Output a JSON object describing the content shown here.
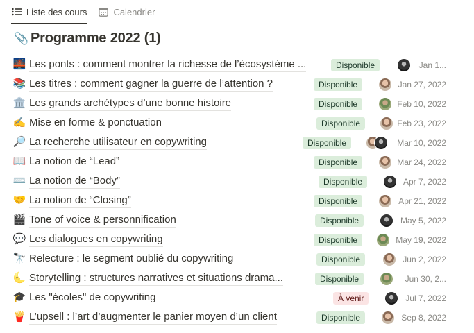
{
  "tabs": [
    {
      "label": "Liste des cours",
      "icon": "list-icon",
      "active": true
    },
    {
      "label": "Calendrier",
      "icon": "calendar-icon",
      "active": false
    }
  ],
  "page": {
    "title": "Programme 2022 (1)",
    "icon": "paperclip-icon"
  },
  "status_colors": {
    "Disponible": "#dbeddb",
    "À venir": "#fbe4e4"
  },
  "rows": [
    {
      "icon": "🌉",
      "name": "Les ponts : comment montrer la richesse de l’écosystème ...",
      "status": "Disponible",
      "date": "Jan 1..."
    },
    {
      "icon": "📚",
      "name": "Les titres : comment gagner la guerre de l’attention ?",
      "status": "Disponible",
      "date": "Jan 27, 2022"
    },
    {
      "icon": "🏛️",
      "name": "Les grands archétypes d’une bonne histoire",
      "status": "Disponible",
      "date": "Feb 10, 2022"
    },
    {
      "icon": "✍️",
      "name": "Mise en forme & ponctuation",
      "status": "Disponible",
      "date": "Feb 23, 2022"
    },
    {
      "icon": "🔎",
      "name": "La recherche utilisateur en copywriting",
      "status": "Disponible",
      "date": "Mar 10, 2022"
    },
    {
      "icon": "📖",
      "name": "La notion de “Lead”",
      "status": "Disponible",
      "date": "Mar 24, 2022"
    },
    {
      "icon": "⌨️",
      "name": "La notion de “Body”",
      "status": "Disponible",
      "date": "Apr 7, 2022"
    },
    {
      "icon": "🤝",
      "name": "La notion de “Closing”",
      "status": "Disponible",
      "date": "Apr 21, 2022"
    },
    {
      "icon": "🎬",
      "name": "Tone of voice & personnification",
      "status": "Disponible",
      "date": "May 5, 2022"
    },
    {
      "icon": "💬",
      "name": "Les dialogues en copywriting",
      "status": "Disponible",
      "date": "May 19, 2022"
    },
    {
      "icon": "🔭",
      "name": "Relecture : le segment oublié du copywriting",
      "status": "Disponible",
      "date": "Jun 2, 2022"
    },
    {
      "icon": "🌜",
      "name": "Storytelling : structures narratives et situations drama...",
      "status": "Disponible",
      "date": "Jun 30, 2..."
    },
    {
      "icon": "🎓",
      "name": "Les \"écoles\" de copywriting",
      "status": "À venir",
      "date": "Jul 7, 2022"
    },
    {
      "icon": "🍟",
      "name": "L’upsell : l’art d’augmenter le panier moyen d’un client",
      "status": "Disponible",
      "date": "Sep 8, 2022"
    }
  ]
}
